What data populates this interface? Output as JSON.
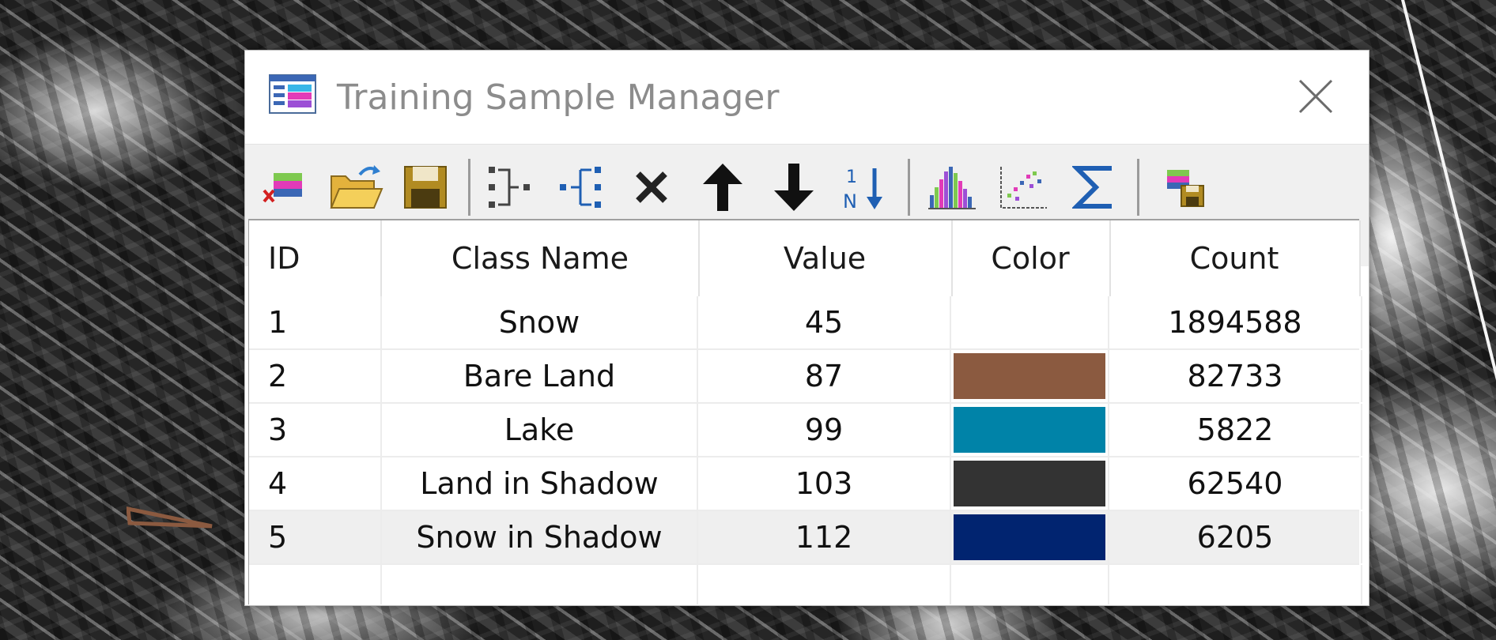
{
  "window": {
    "title": "Training Sample Manager"
  },
  "toolbar": {
    "buttons": [
      {
        "name": "remove-layer-icon"
      },
      {
        "name": "open-folder-icon"
      },
      {
        "name": "save-icon"
      },
      {
        "name": "collapse-icon"
      },
      {
        "name": "split-icon"
      },
      {
        "name": "delete-icon"
      },
      {
        "name": "move-up-icon"
      },
      {
        "name": "move-down-icon"
      },
      {
        "name": "reset-class-values-icon"
      },
      {
        "name": "histogram-icon"
      },
      {
        "name": "scatterplot-icon"
      },
      {
        "name": "statistics-icon"
      },
      {
        "name": "save-edits-icon"
      }
    ]
  },
  "table": {
    "headers": {
      "id": "ID",
      "class_name": "Class Name",
      "value": "Value",
      "color": "Color",
      "count": "Count"
    },
    "rows": [
      {
        "id": "1",
        "class_name": "Snow",
        "value": "45",
        "color": "#ffffff",
        "count": "1894588"
      },
      {
        "id": "2",
        "class_name": "Bare Land",
        "value": "87",
        "color": "#8b5a40",
        "count": "82733"
      },
      {
        "id": "3",
        "class_name": "Lake",
        "value": "99",
        "color": "#0083a8",
        "count": "5822"
      },
      {
        "id": "4",
        "class_name": "Land in Shadow",
        "value": "103",
        "color": "#333333",
        "count": "62540"
      },
      {
        "id": "5",
        "class_name": "Snow in Shadow",
        "value": "112",
        "color": "#012470",
        "count": "6205"
      }
    ],
    "selected_row": "5"
  }
}
